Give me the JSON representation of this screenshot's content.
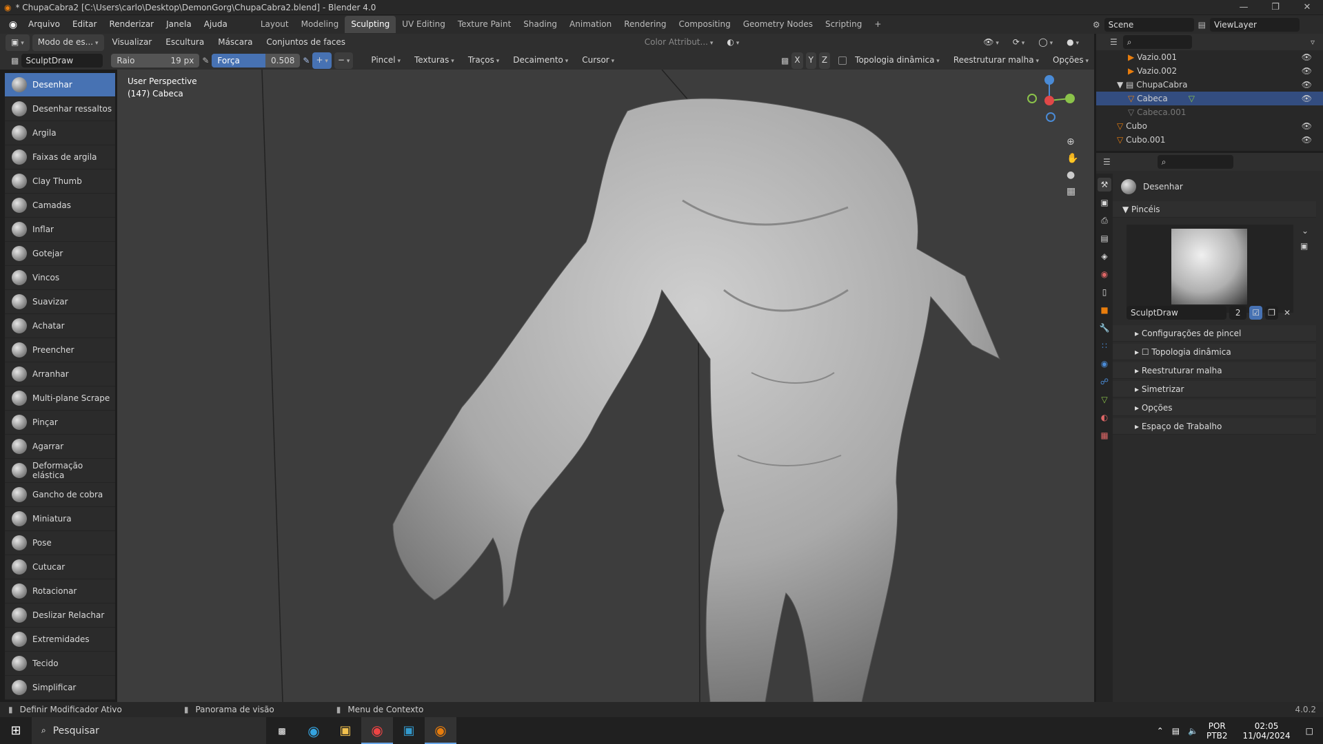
{
  "window": {
    "title": "* ChupaCabra2 [C:\\Users\\carlo\\Desktop\\DemonGorg\\ChupaCabra2.blend] - Blender 4.0"
  },
  "menu": {
    "items": [
      "Arquivo",
      "Editar",
      "Renderizar",
      "Janela",
      "Ajuda"
    ]
  },
  "workspaces": [
    "Layout",
    "Modeling",
    "Sculpting",
    "UV Editing",
    "Texture Paint",
    "Shading",
    "Animation",
    "Rendering",
    "Compositing",
    "Geometry Nodes",
    "Scripting"
  ],
  "active_workspace": "Sculpting",
  "scene": {
    "name": "Scene",
    "viewlayer": "ViewLayer"
  },
  "header1": {
    "mode": "Modo de es...",
    "items": [
      "Visualizar",
      "Escultura",
      "Máscara",
      "Conjuntos de faces"
    ],
    "color_attr": "Color Attribut..."
  },
  "header2": {
    "brush_name": "SculptDraw",
    "radius_label": "Raio",
    "radius_value": "19 px",
    "strength_label": "Força",
    "strength_value": "0.508",
    "dropdowns": [
      "Pincel",
      "Texturas",
      "Traços",
      "Decaimento",
      "Cursor"
    ],
    "axes": [
      "X",
      "Y",
      "Z"
    ],
    "dyntopo": "Topologia dinâmica",
    "remesh": "Reestruturar malha",
    "options": "Opções"
  },
  "tools": [
    "Desenhar",
    "Desenhar ressaltos",
    "Argila",
    "Faixas de argila",
    "Clay Thumb",
    "Camadas",
    "Inflar",
    "Gotejar",
    "Vincos",
    "Suavizar",
    "Achatar",
    "Preencher",
    "Arranhar",
    "Multi-plane Scrape",
    "Pinçar",
    "Agarrar",
    "Deformação elástica",
    "Gancho de cobra",
    "Miniatura",
    "Pose",
    "Cutucar",
    "Rotacionar",
    "Deslizar Relachar",
    "Extremidades",
    "Tecido",
    "Simplificar"
  ],
  "active_tool": "Desenhar",
  "viewport": {
    "perspective": "User Perspective",
    "object": "(147) Cabeca"
  },
  "outliner": {
    "rows": [
      "Vazio.001",
      "Vazio.002",
      "ChupaCabra",
      "Cabeca",
      "Cabeca.001",
      "Cubo",
      "Cubo.001"
    ]
  },
  "properties": {
    "tool_name": "Desenhar",
    "brushes_section": "Pincéis",
    "brush_name": "SculptDraw",
    "brush_users": "2",
    "sections": [
      "Configurações de pincel",
      "Topologia dinâmica",
      "Reestruturar malha",
      "Simetrizar",
      "Opções",
      "Espaço de Trabalho"
    ]
  },
  "statusbar": {
    "left": "Definir Modificador Ativo",
    "mid": "Panorama de visão",
    "ctx": "Menu de Contexto",
    "version": "4.0.2"
  },
  "taskbar": {
    "search": "Pesquisar",
    "lang": "POR",
    "layout": "PTB2",
    "time": "02:05",
    "date": "11/04/2024"
  },
  "colors": {
    "accent": "#4772b3",
    "orange": "#e87d0d",
    "viewport": "#3d3d3d"
  }
}
